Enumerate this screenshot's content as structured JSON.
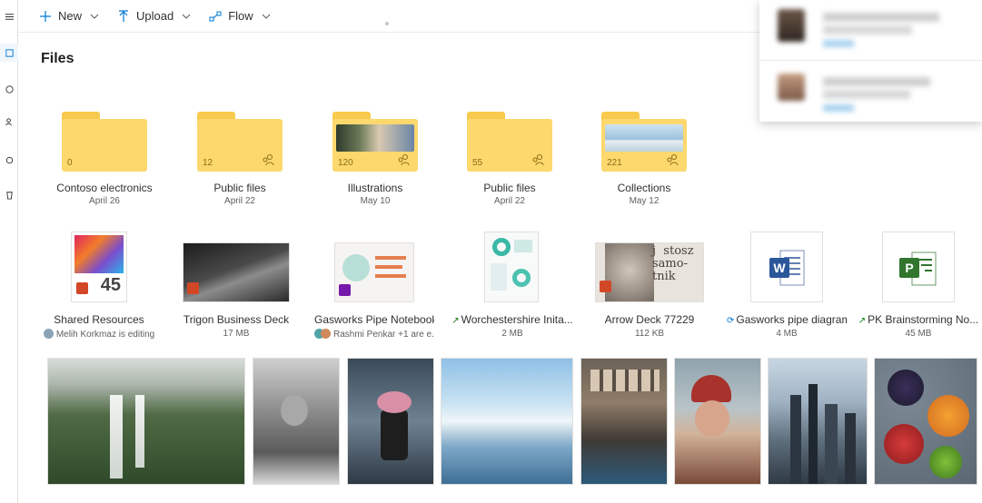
{
  "commands": [
    {
      "label": "New",
      "icon": "plus-icon"
    },
    {
      "label": "Upload",
      "icon": "upload-icon"
    },
    {
      "label": "Flow",
      "icon": "flow-icon"
    }
  ],
  "page_title": "Files",
  "folders": [
    {
      "name": "Contoso electronics",
      "date": "April 26",
      "count": "0",
      "shared": false
    },
    {
      "name": "Public files",
      "date": "April 22",
      "count": "12",
      "shared": true
    },
    {
      "name": "Illustrations",
      "date": "May 10",
      "count": "120",
      "shared": true
    },
    {
      "name": "Public files",
      "date": "April 22",
      "count": "55",
      "shared": true
    },
    {
      "name": "Collections",
      "date": "May 12",
      "count": "221",
      "shared": true
    }
  ],
  "files": [
    {
      "name": "Shared Resources",
      "meta": "Melih Korkmaz is editing",
      "icon": "powerpoint-icon",
      "thumb_text": "45",
      "trending": false
    },
    {
      "name": "Trigon Business Deck",
      "meta": "17 MB",
      "icon": "powerpoint-icon",
      "trending": false
    },
    {
      "name": "Gasworks Pipe Notebook",
      "meta": "Rashmi Penkar +1 are e...",
      "icon": "onenote-icon",
      "trending": false
    },
    {
      "name": "Worchestershire Inita...",
      "meta": "2 MB",
      "icon": "document-icon",
      "trending": true
    },
    {
      "name": "Arrow Deck 77229",
      "meta": "112 KB",
      "icon": "powerpoint-icon",
      "thumb_text": "j  stosz\nsamo-\ntnik",
      "trending": false
    },
    {
      "name": "Gasworks pipe diagram",
      "meta": "4 MB",
      "icon": "word-icon",
      "trending": true
    },
    {
      "name": "PK Brainstorming No...",
      "meta": "45 MB",
      "icon": "project-icon",
      "trending": true
    }
  ],
  "photos": [
    {
      "name": "waterfall-photo"
    },
    {
      "name": "man-reading-photo"
    },
    {
      "name": "flower-vase-photo"
    },
    {
      "name": "ocean-ice-photo"
    },
    {
      "name": "market-bicycles-photo"
    },
    {
      "name": "man-beanie-photo"
    },
    {
      "name": "city-skyline-photo"
    },
    {
      "name": "fruit-bowls-photo"
    }
  ],
  "colors": {
    "folder": "#fcd86d",
    "folder_tab": "#f8ca4e",
    "accent": "#0078d4",
    "word": "#2b579a",
    "project": "#31752f",
    "powerpoint": "#d24726",
    "onenote": "#7719aa"
  }
}
